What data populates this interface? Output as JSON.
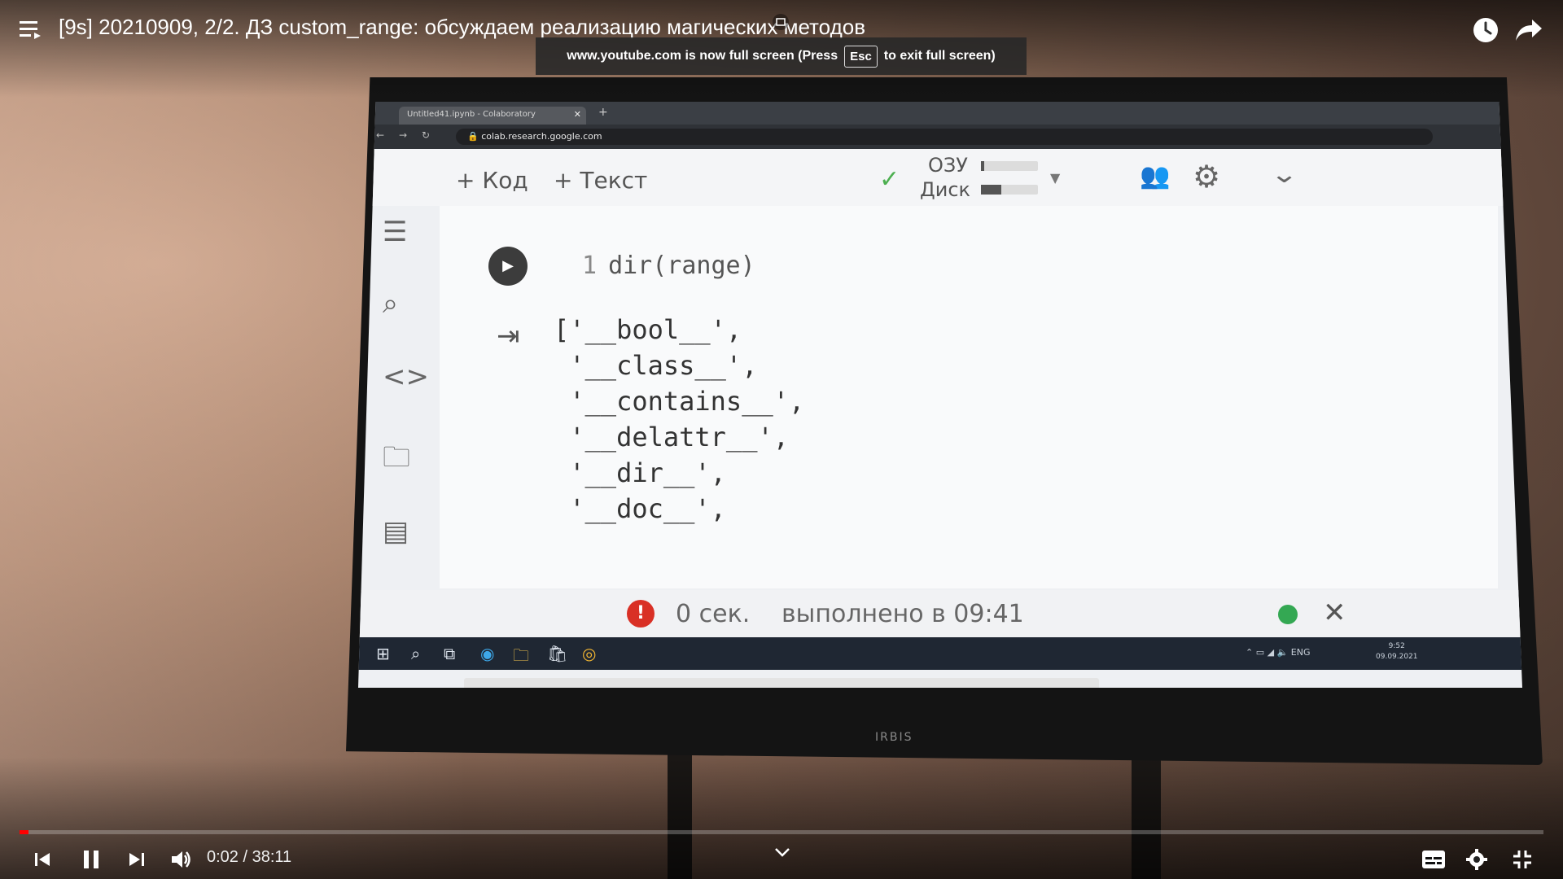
{
  "youtube": {
    "title": "[9s] 20210909, 2/2. ДЗ custom_range: обсуждаем реализацию магических методов",
    "fullscreen_toast": {
      "prefix": "www.youtube.com is now full screen (Press",
      "key": "Esc",
      "suffix": "to exit full screen)"
    },
    "time": {
      "current": "0:02",
      "separator": " / ",
      "duration": "38:11"
    },
    "progress_fraction": 0.0009,
    "icons": [
      "playlist-icon",
      "watch-later-icon",
      "share-icon",
      "previous-icon",
      "pause-icon",
      "next-icon",
      "volume-icon",
      "chevron-down-icon",
      "subtitles-icon",
      "settings-icon",
      "exit-fullscreen-icon"
    ],
    "colors": {
      "progress": "#ff0000",
      "text": "#ffffff"
    }
  },
  "tv": {
    "brand": "IRBIS",
    "browser": {
      "tab_title": "Untitled41.ipynb - Colaboratory",
      "url": "colab.research.google.com"
    },
    "colab": {
      "toolbar": {
        "add_code": "+ Код",
        "add_text": "+ Текст",
        "ram_label": "ОЗУ",
        "disk_label": "Диск",
        "ram_fraction": 0.05,
        "disk_fraction": 0.35
      },
      "cell": {
        "line_number": "1",
        "code": "dir(range)",
        "output_lines": [
          "['__bool__',",
          " '__class__',",
          " '__contains__',",
          " '__delattr__',",
          " '__dir__',",
          " '__doc__',"
        ]
      },
      "status": {
        "elapsed": "0 сек.",
        "done": "выполнено в 09:41"
      }
    },
    "taskbar": {
      "lang": "ENG",
      "time": "9:52",
      "date": "09.09.2021"
    }
  }
}
